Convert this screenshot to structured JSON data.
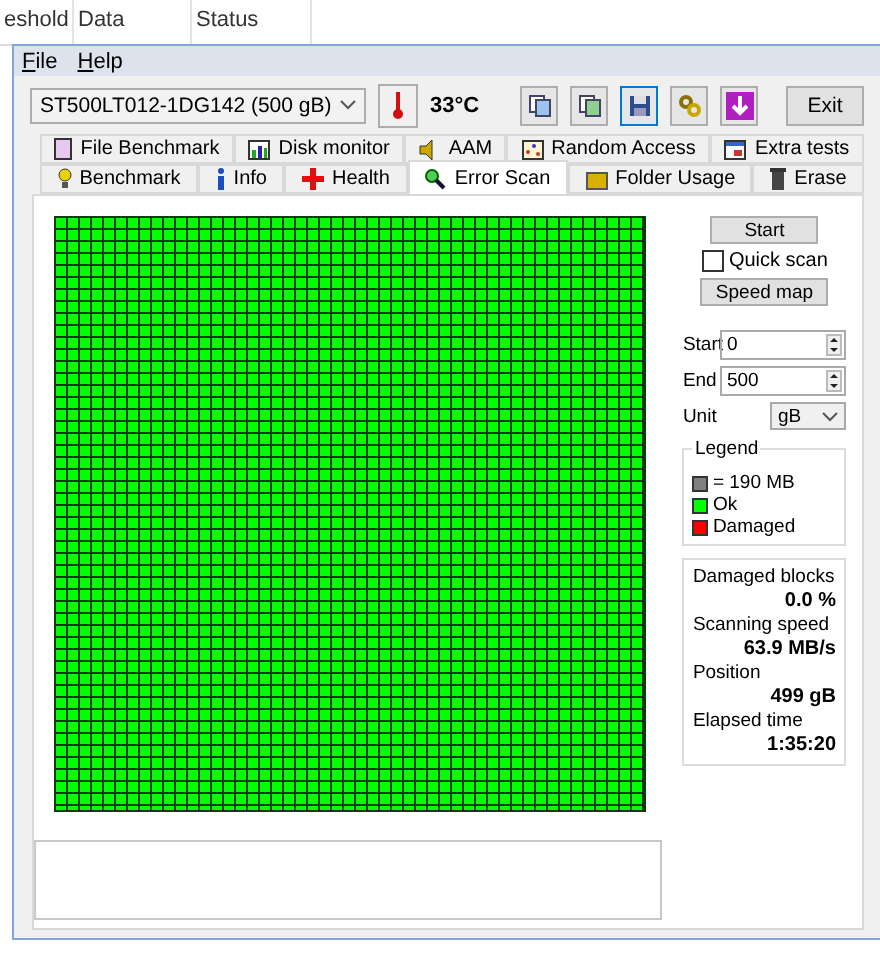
{
  "background_columns": [
    "eshold",
    "Data",
    "Status"
  ],
  "menu": [
    "File",
    "Help"
  ],
  "toolbar": {
    "drive": "ST500LT012-1DG142 (500 gB)",
    "temperature": "33°C",
    "exit": "Exit",
    "buttons": [
      {
        "kind": "copy",
        "selected": false
      },
      {
        "kind": "copy-green",
        "selected": false
      },
      {
        "kind": "save",
        "selected": true
      },
      {
        "kind": "options",
        "selected": false
      },
      {
        "kind": "download",
        "selected": false
      }
    ]
  },
  "tab_rows": [
    [
      {
        "label": "File Benchmark",
        "kind": "filebench",
        "selected": false
      },
      {
        "label": "Disk monitor",
        "kind": "monitor",
        "selected": false
      },
      {
        "label": "AAM",
        "kind": "speaker",
        "selected": false
      },
      {
        "label": "Random Access",
        "kind": "random",
        "selected": false
      },
      {
        "label": "Extra tests",
        "kind": "extra",
        "selected": false
      }
    ],
    [
      {
        "label": "Benchmark",
        "kind": "bulb",
        "selected": false
      },
      {
        "label": "Info",
        "kind": "info",
        "selected": false
      },
      {
        "label": "Health",
        "kind": "cross",
        "selected": false
      },
      {
        "label": "Error Scan",
        "kind": "magnifier",
        "selected": true
      },
      {
        "label": "Folder Usage",
        "kind": "folder",
        "selected": false
      },
      {
        "label": "Erase",
        "kind": "bin",
        "selected": false
      }
    ]
  ],
  "controls": {
    "start_button": "Start",
    "quick_scan": {
      "label": "Quick scan",
      "checked": false
    },
    "speed_map_button": "Speed map",
    "start": {
      "label": "Start",
      "value": "0"
    },
    "end": {
      "label": "End",
      "value": "500"
    },
    "unit": {
      "label": "Unit",
      "value": "gB"
    }
  },
  "legend": {
    "title": "Legend",
    "items": [
      {
        "label": "= 190 MB",
        "color": "#808080"
      },
      {
        "label": "Ok",
        "color": "#00ff00"
      },
      {
        "label": "Damaged",
        "color": "#ff0000"
      }
    ]
  },
  "stats": [
    {
      "label": "Damaged blocks",
      "value": "0.0 %"
    },
    {
      "label": "Scanning speed",
      "value": "63.9 MB/s"
    },
    {
      "label": "Position",
      "value": "499 gB"
    },
    {
      "label": "Elapsed time",
      "value": "1:35:20"
    }
  ]
}
